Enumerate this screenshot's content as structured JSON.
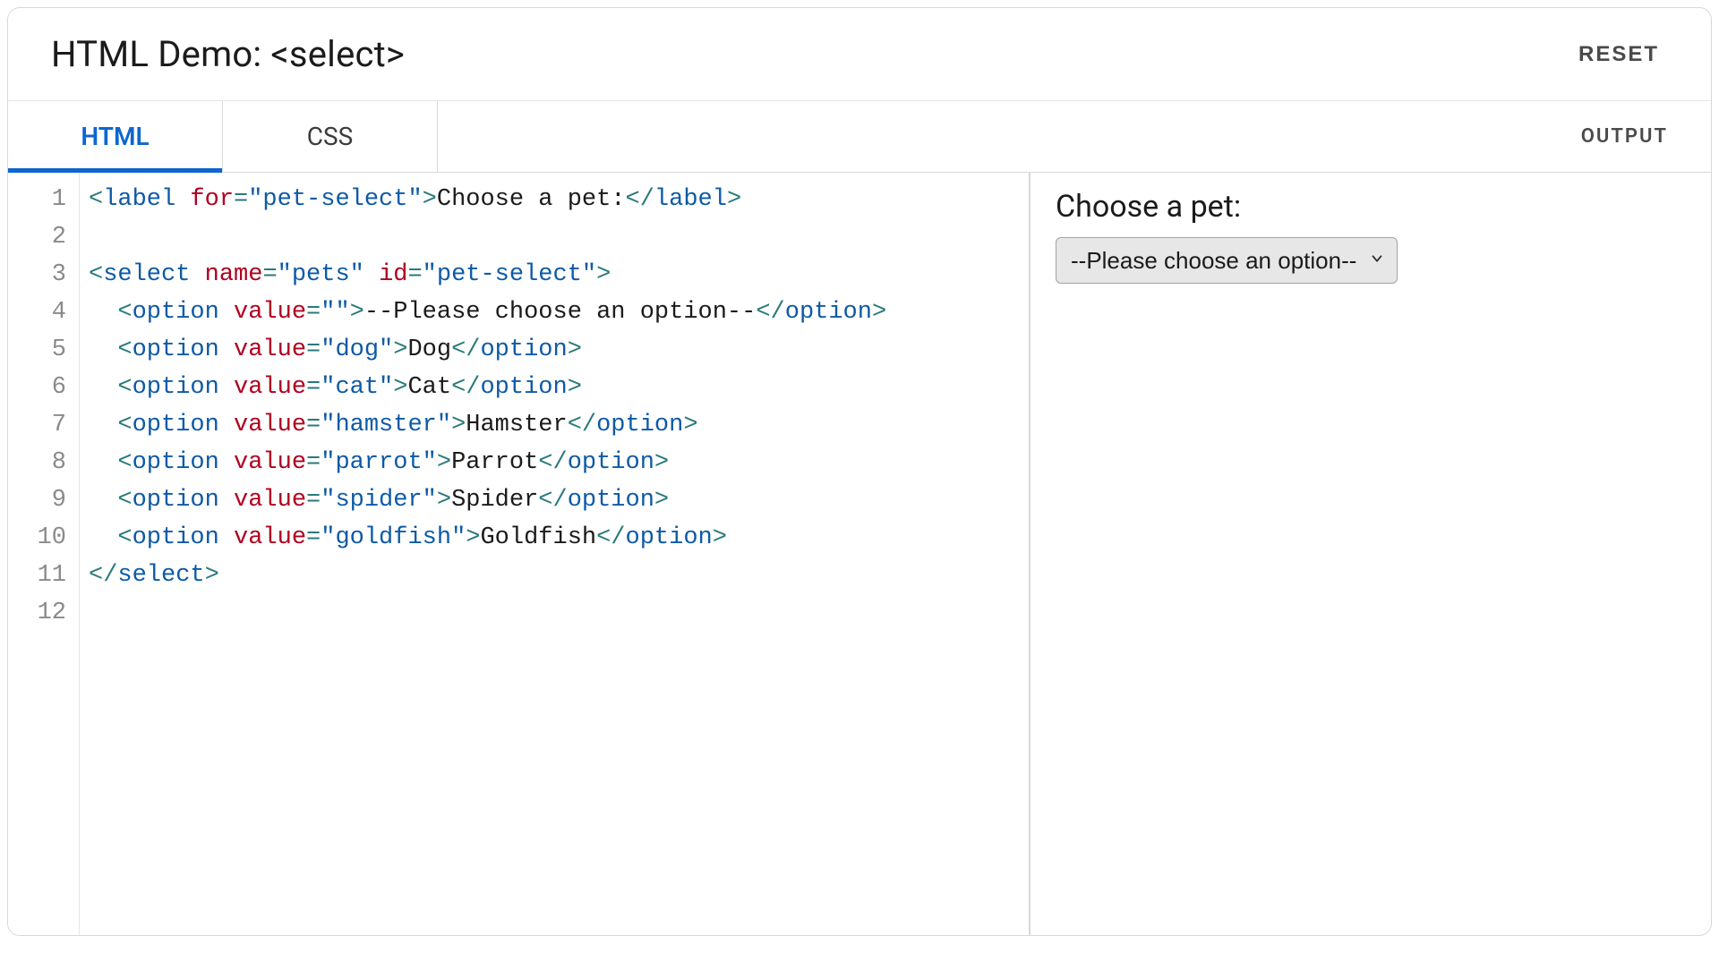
{
  "header": {
    "title": "HTML Demo: <select>",
    "reset_label": "RESET"
  },
  "tabs": {
    "html_label": "HTML",
    "css_label": "CSS",
    "output_label": "OUTPUT"
  },
  "editor": {
    "line_numbers": [
      "1",
      "2",
      "3",
      "4",
      "5",
      "6",
      "7",
      "8",
      "9",
      "10",
      "11",
      "12"
    ],
    "lines": [
      {
        "type": "label_open",
        "for": "pet-select",
        "text": "Choose a pet:",
        "close": "label"
      },
      {
        "type": "blank"
      },
      {
        "type": "select_open",
        "name": "pets",
        "id": "pet-select"
      },
      {
        "type": "option_wrap",
        "value": "",
        "text": "--Please choose an option--"
      },
      {
        "type": "option",
        "value": "dog",
        "text": "Dog"
      },
      {
        "type": "option",
        "value": "cat",
        "text": "Cat"
      },
      {
        "type": "option",
        "value": "hamster",
        "text": "Hamster"
      },
      {
        "type": "option",
        "value": "parrot",
        "text": "Parrot"
      },
      {
        "type": "option",
        "value": "spider",
        "text": "Spider"
      },
      {
        "type": "option",
        "value": "goldfish",
        "text": "Goldfish"
      },
      {
        "type": "select_close"
      },
      {
        "type": "blank"
      }
    ]
  },
  "output": {
    "label_text": "Choose a pet:",
    "select_name": "pets",
    "select_id": "pet-select",
    "selected_value": "",
    "options": [
      {
        "value": "",
        "label": "--Please choose an option--"
      },
      {
        "value": "dog",
        "label": "Dog"
      },
      {
        "value": "cat",
        "label": "Cat"
      },
      {
        "value": "hamster",
        "label": "Hamster"
      },
      {
        "value": "parrot",
        "label": "Parrot"
      },
      {
        "value": "spider",
        "label": "Spider"
      },
      {
        "value": "goldfish",
        "label": "Goldfish"
      }
    ]
  },
  "colors": {
    "accent": "#0d66d0",
    "border": "#d8d8d8",
    "tag": "#0d5aa7",
    "attr": "#b00020",
    "punct": "#2a7a7a"
  }
}
